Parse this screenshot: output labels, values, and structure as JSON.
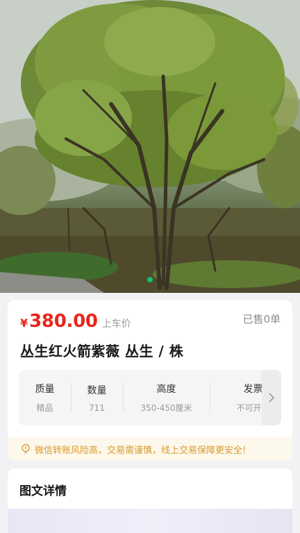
{
  "hero": {
    "image": "flowering-tree-photo",
    "pager_count": 1,
    "pager_active_color": "#14c26b"
  },
  "product": {
    "currency": "¥",
    "price": "380.00",
    "price_note": "上车价",
    "sold": "已售0单",
    "title": "丛生红火箭紫薇 丛生 / 株",
    "price_color": "#e8261c"
  },
  "specs": [
    {
      "label": "质量",
      "value": "精品"
    },
    {
      "label": "数量",
      "value": "711"
    },
    {
      "label": "高度",
      "value": "350-450厘米"
    },
    {
      "label": "发票",
      "value": "不可开票"
    }
  ],
  "specs_more_icon": "chevron-right-icon",
  "warning": {
    "icon": "lightbulb-icon",
    "text": "微信转账风险高，交易需谨慎，线上交易保障更安全!",
    "color": "#d99a2b"
  },
  "detail": {
    "title": "图文详情"
  }
}
